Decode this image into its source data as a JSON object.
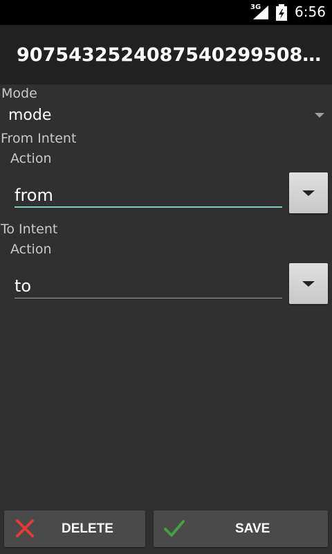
{
  "status": {
    "network": "3G",
    "time": "6:56"
  },
  "app": {
    "title": "9075432524087540299508…"
  },
  "form": {
    "mode_label": "Mode",
    "mode_value": "mode",
    "from_intent_label": "From Intent",
    "from_action_label": "Action",
    "from_action_value": "from",
    "to_intent_label": "To Intent",
    "to_action_label": "Action",
    "to_action_value": "to"
  },
  "buttons": {
    "delete_label": "DELETE",
    "save_label": "SAVE"
  },
  "colors": {
    "background": "#303030",
    "actionbar": "#212121",
    "focus_underline": "#80cbc4",
    "delete_icon": "#e53935",
    "save_icon": "#43a047"
  }
}
